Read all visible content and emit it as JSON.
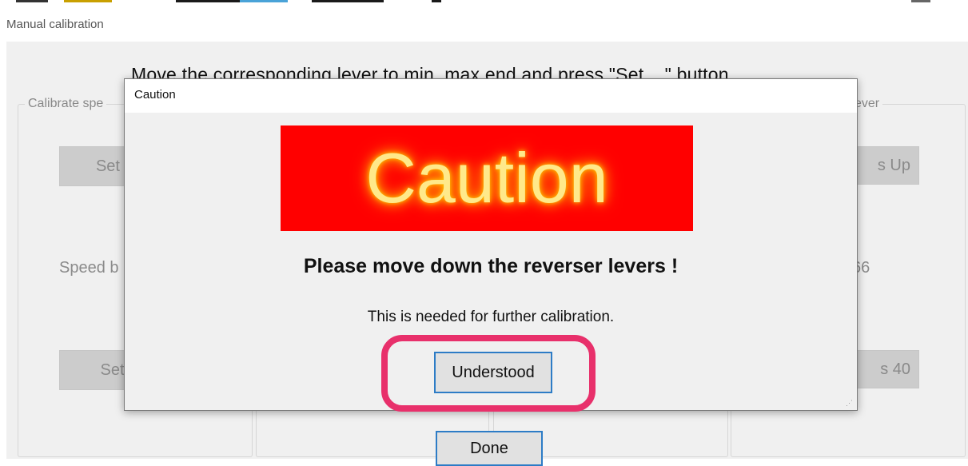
{
  "window": {
    "title": "Manual calibration"
  },
  "main": {
    "instruction": "Move the corresponding lever to min, max end and press \"Set ...\" button",
    "left_group": {
      "legend": "Calibrate spe",
      "set_top_button": "Set Sp",
      "speed_text": "Speed b",
      "set_bottom_button": "Set S"
    },
    "right_group": {
      "legend": "ever",
      "set_top_button": "s Up",
      "value_text": "66",
      "set_bottom_button": "s 40"
    },
    "done_button": "Done"
  },
  "dialog": {
    "title": "Caution",
    "banner_text": "Caution",
    "message": "Please move down the reverser levers !",
    "submessage": "This is needed for further calibration.",
    "understood_button": "Understood"
  },
  "colors": {
    "banner_bg": "#ff0000",
    "banner_text": "#ffe98a",
    "focus_border": "#2d7cc6",
    "highlight": "#e8306b"
  }
}
